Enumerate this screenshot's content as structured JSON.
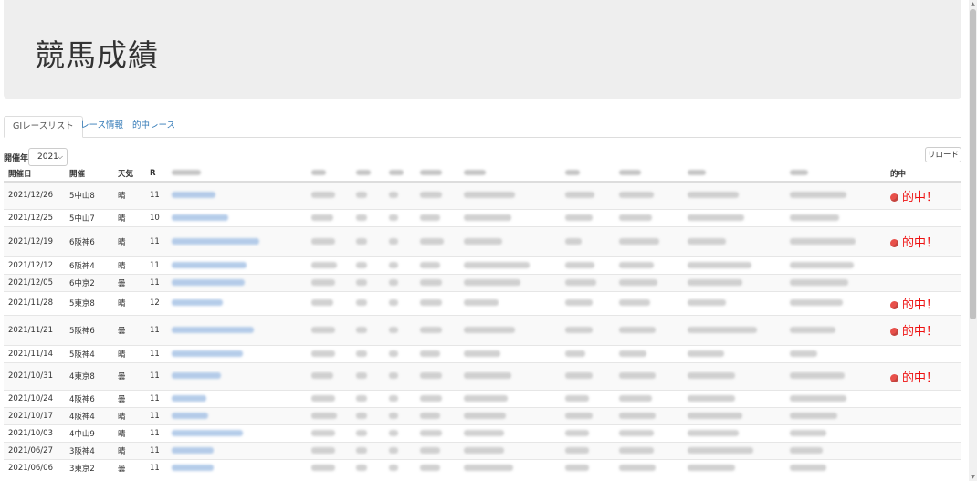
{
  "header": {
    "title": "競馬成績"
  },
  "tabs": [
    {
      "label": "GIレースリスト",
      "active": true
    },
    {
      "label": "レース情報",
      "active": false
    },
    {
      "label": "的中レース",
      "active": false
    }
  ],
  "filter": {
    "year_label": "開催年",
    "year_value": "2021"
  },
  "reload_label": "リロード",
  "table": {
    "columns": [
      "開催日",
      "開催",
      "天気",
      "R",
      "",
      "",
      "",
      "",
      "",
      "",
      "",
      "",
      "",
      "",
      "的中"
    ],
    "rows": [
      {
        "date": "2021/12/26",
        "venue": "5中山8",
        "weather": "晴",
        "r": "11",
        "hit": "的中！"
      },
      {
        "date": "2021/12/25",
        "venue": "5中山7",
        "weather": "晴",
        "r": "10",
        "hit": ""
      },
      {
        "date": "2021/12/19",
        "venue": "6阪神6",
        "weather": "晴",
        "r": "11",
        "hit": "的中！"
      },
      {
        "date": "2021/12/12",
        "venue": "6阪神4",
        "weather": "晴",
        "r": "11",
        "hit": ""
      },
      {
        "date": "2021/12/05",
        "venue": "6中京2",
        "weather": "曇",
        "r": "11",
        "hit": ""
      },
      {
        "date": "2021/11/28",
        "venue": "5東京8",
        "weather": "晴",
        "r": "12",
        "hit": "的中！"
      },
      {
        "date": "2021/11/21",
        "venue": "5阪神6",
        "weather": "曇",
        "r": "11",
        "hit": "的中！"
      },
      {
        "date": "2021/11/14",
        "venue": "5阪神4",
        "weather": "晴",
        "r": "11",
        "hit": ""
      },
      {
        "date": "2021/10/31",
        "venue": "4東京8",
        "weather": "曇",
        "r": "11",
        "hit": "的中！"
      },
      {
        "date": "2021/10/24",
        "venue": "4阪神6",
        "weather": "曇",
        "r": "11",
        "hit": ""
      },
      {
        "date": "2021/10/17",
        "venue": "4阪神4",
        "weather": "晴",
        "r": "11",
        "hit": ""
      },
      {
        "date": "2021/10/03",
        "venue": "4中山9",
        "weather": "晴",
        "r": "11",
        "hit": ""
      },
      {
        "date": "2021/06/27",
        "venue": "3阪神4",
        "weather": "晴",
        "r": "11",
        "hit": ""
      },
      {
        "date": "2021/06/06",
        "venue": "3東京2",
        "weather": "曇",
        "r": "11",
        "hit": ""
      }
    ]
  },
  "colors": {
    "hit": "#ee1111",
    "link": "#337ab7"
  }
}
